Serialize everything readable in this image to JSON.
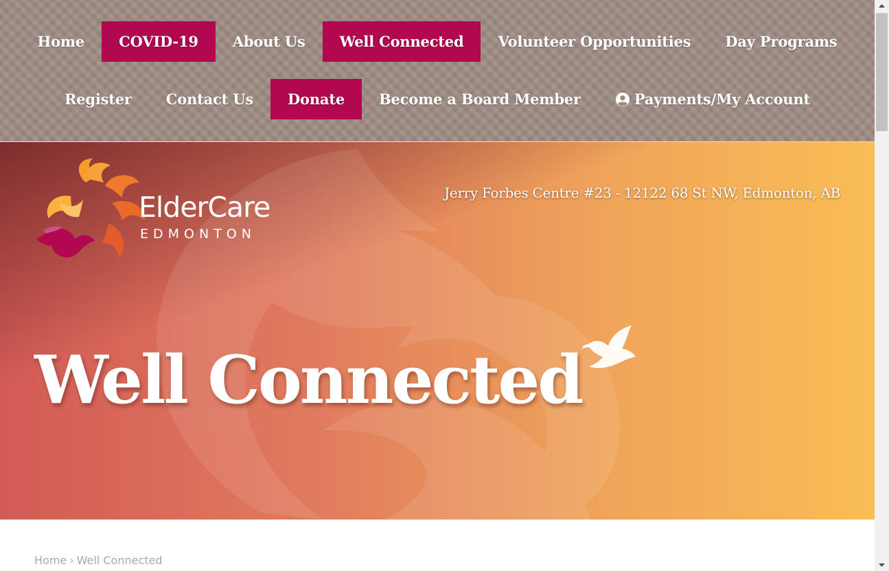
{
  "nav": {
    "row1": [
      {
        "label": "Home",
        "active": false
      },
      {
        "label": "COVID-19",
        "active": true
      },
      {
        "label": "About Us",
        "active": false
      },
      {
        "label": "Well Connected",
        "active": true
      },
      {
        "label": "Volunteer Opportunities",
        "active": false
      },
      {
        "label": "Day Programs",
        "active": false
      }
    ],
    "row2": [
      {
        "label": "Register",
        "active": false
      },
      {
        "label": "Contact Us",
        "active": false
      },
      {
        "label": "Donate",
        "active": true
      },
      {
        "label": "Become a Board Member",
        "active": false
      },
      {
        "label": "Payments/My Account",
        "active": false,
        "icon": "account-icon"
      }
    ]
  },
  "logo": {
    "name": "ElderCare",
    "subtitle": "EDMONTON"
  },
  "hero": {
    "address": "Jerry Forbes Centre #23 - 12122 68 St NW, Edmonton, AB",
    "title": "Well Connected"
  },
  "breadcrumb": {
    "home": "Home",
    "separator": "›",
    "current": "Well Connected"
  },
  "colors": {
    "nav_bg": "#9c8a80",
    "active_bg": "#b1084f",
    "hero_left": "#d25b56",
    "hero_right": "#fabd55"
  }
}
